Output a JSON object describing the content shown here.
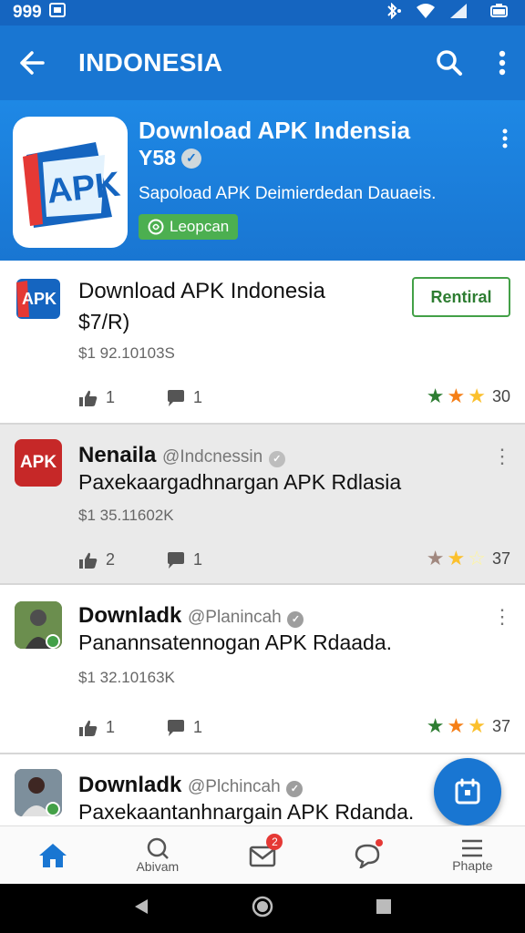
{
  "status_bar": {
    "time": "999",
    "icons": [
      "gallery-icon",
      "bluetooth-icon",
      "wifi-icon",
      "signal-icon",
      "battery-icon"
    ]
  },
  "app_bar": {
    "title": "INDONESIA"
  },
  "hero": {
    "title": "Download APK Indensia",
    "subtitle": "Y58",
    "description": "Sapoload APK Deimierdedan Dauaeis.",
    "badge": "Leopcan",
    "logo_text": "APK"
  },
  "cards": [
    {
      "avatar_text": "APK",
      "title": "Download APK Indonesia",
      "line2": "$7/R)",
      "meta": "$1 92.10103S",
      "button": "Rentiral",
      "likes": "1",
      "comments": "1",
      "rating": "30"
    },
    {
      "avatar_text": "APK",
      "title": "Nenaila",
      "handle": "@Indcnessin",
      "line2": "Paxekaargadhnargan APK Rdlasia",
      "meta": "$1 35.11602K",
      "likes": "2",
      "comments": "1",
      "rating": "37"
    },
    {
      "title": "Downladk",
      "handle": "@Planincah",
      "line2": "Panannsatennogan APK Rdaada.",
      "meta": "$1 32.10163K",
      "likes": "1",
      "comments": "1",
      "rating": "37"
    },
    {
      "title": "Downladk",
      "handle": "@Plchincah",
      "line2": "Paxekaantanhnargain APK Rdanda."
    }
  ],
  "bottom_nav": [
    {
      "label": "",
      "icon": "home-icon"
    },
    {
      "label": "Abivam",
      "icon": "explore-icon"
    },
    {
      "label": "",
      "icon": "inbox-icon",
      "badge": "2"
    },
    {
      "label": "",
      "icon": "chat-icon"
    },
    {
      "label": "Phapte",
      "icon": "menu-icon"
    }
  ],
  "colors": {
    "primary": "#1976d2",
    "dark": "#1565c0",
    "accent_green": "#43a047",
    "star": "#fbc02d",
    "star_green": "#2e7d32"
  }
}
